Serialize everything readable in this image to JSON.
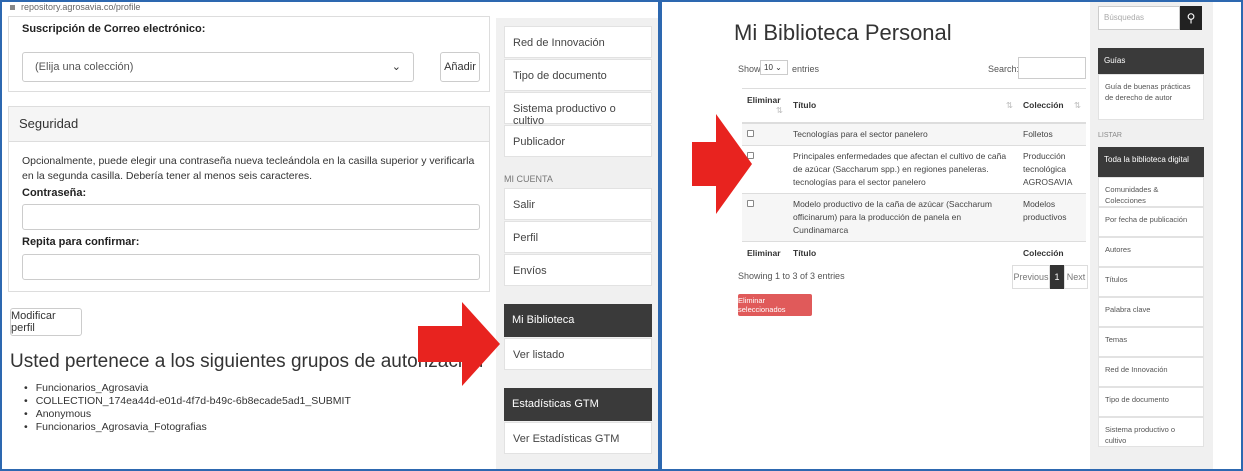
{
  "left": {
    "url": "repository.agrosavia.co/profile",
    "email_subscription": {
      "label": "Suscripción de Correo electrónico:",
      "select_value": "(Elija una colección)",
      "add_button": "Añadir"
    },
    "security": {
      "heading": "Seguridad",
      "description": "Opcionalmente, puede elegir una contraseña nueva tecleándola en la casilla superior y verificarla en la segunda casilla. Debería tener al menos seis caracteres.",
      "password_label": "Contraseña:",
      "confirm_label": "Repita para confirmar:"
    },
    "modify_button": "Modificar perfil",
    "groups_title": "Usted pertenece a los siguientes grupos de autorización",
    "groups": [
      "Funcionarios_Agrosavia",
      "COLLECTION_174ea44d-e01d-4f7d-b49c-6b8ecade5ad1_SUBMIT",
      "Anonymous",
      "Funcionarios_Agrosavia_Fotografias"
    ],
    "sidebar": {
      "browse_items": [
        "Red de Innovación",
        "Tipo de documento",
        "Sistema productivo o cultivo",
        "Publicador"
      ],
      "account_heading": "MI CUENTA",
      "account_items": [
        "Salir",
        "Perfil",
        "Envíos"
      ],
      "library_heading": "Mi Biblioteca",
      "library_item": "Ver listado",
      "stats_heading": "Estadísticas GTM",
      "stats_item": "Ver Estadísticas GTM"
    }
  },
  "right": {
    "title": "Mi Biblioteca Personal",
    "show_label": "Show",
    "entries_value": "10",
    "entries_label": "entries",
    "search_label": "Search:",
    "columns": [
      "Eliminar",
      "Título",
      "Colección"
    ],
    "rows": [
      {
        "title": "Tecnologías para el sector panelero",
        "collection": "Folletos"
      },
      {
        "title": "Principales enfermedades que afectan el cultivo de caña de azúcar (Saccharum spp.) en regiones paneleras. tecnologías para el sector panelero",
        "collection": "Producción tecnológica AGROSAVIA"
      },
      {
        "title": "Modelo productivo de la caña de azúcar (Saccharum officinarum) para la producción de panela en Cundinamarca",
        "collection": "Modelos productivos"
      }
    ],
    "showing": "Showing 1 to 3 of 3 entries",
    "pager": {
      "previous": "Previous",
      "current": "1",
      "next": "Next"
    },
    "delete_button": "Eliminar seleccionados",
    "sidebar": {
      "search_placeholder": "Búsquedas",
      "guides_heading": "Guías",
      "guide_item": "Guía de buenas prácticas de derecho de autor",
      "list_heading": "LISTAR",
      "whole_library": "Toda la biblioteca digital",
      "items": [
        "Comunidades & Colecciones",
        "Por fecha de publicación",
        "Autores",
        "Títulos",
        "Palabra clave",
        "Temas",
        "Red de Innovación",
        "Tipo de documento",
        "Sistema productivo o cultivo"
      ]
    }
  },
  "colors": {
    "frame": "#2d68b0",
    "arrow": "#e8231f",
    "dark_header": "#3a3a3a",
    "delete": "#e05a5a"
  }
}
